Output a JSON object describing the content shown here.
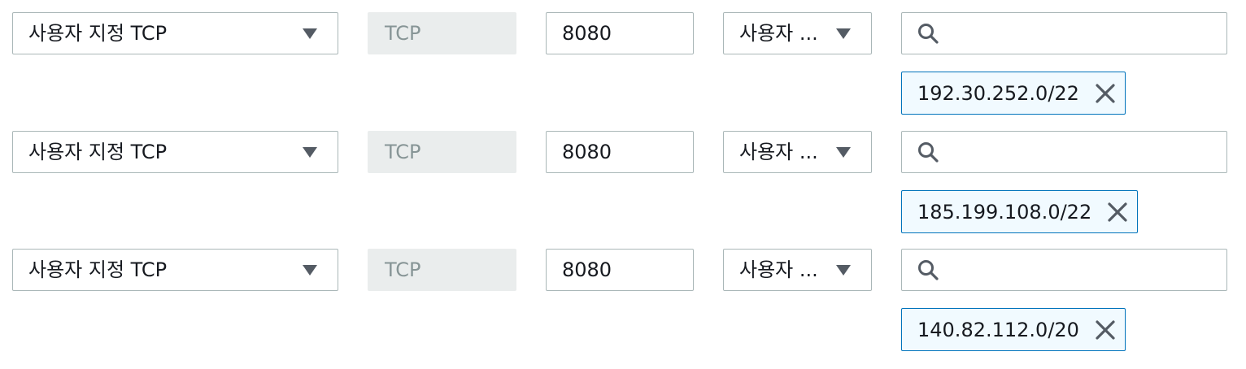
{
  "rules": [
    {
      "type": "사용자 지정 TCP",
      "protocol": "TCP",
      "port_range": "8080",
      "source": "사용자 ...",
      "search_placeholder": "",
      "cidr": "192.30.252.0/22"
    },
    {
      "type": "사용자 지정 TCP",
      "protocol": "TCP",
      "port_range": "8080",
      "source": "사용자 ...",
      "search_placeholder": "",
      "cidr": "185.199.108.0/22"
    },
    {
      "type": "사용자 지정 TCP",
      "protocol": "TCP",
      "port_range": "8080",
      "source": "사용자 ...",
      "search_placeholder": "",
      "cidr": "140.82.112.0/20"
    }
  ],
  "icons": {
    "dropdown": "caret-down-icon",
    "search": "search-icon",
    "remove": "close-icon"
  },
  "colors": {
    "border": "#aab7b8",
    "disabled_fill": "#eaeded",
    "disabled_text": "#879596",
    "token_border": "#0073bb",
    "token_fill": "#f1faff",
    "icon": "#545b64"
  }
}
